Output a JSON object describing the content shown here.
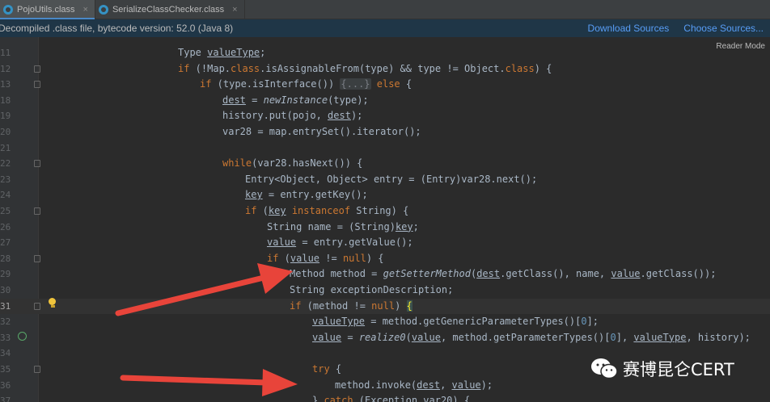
{
  "tabs": [
    {
      "label": "PojoUtils.class",
      "active": true
    },
    {
      "label": "SerializeClassChecker.class",
      "active": false
    }
  ],
  "close_glyph": "×",
  "banner": {
    "message": "Decompiled .class file, bytecode version: 52.0 (Java 8)",
    "download_sources": "Download Sources",
    "choose_sources": "Choose Sources..."
  },
  "reader_mode": "Reader Mode",
  "line_numbers": [
    "11",
    "12",
    "13",
    "18",
    "19",
    "20",
    "21",
    "22",
    "23",
    "24",
    "25",
    "26",
    "27",
    "28",
    "29",
    "30",
    "31",
    "32",
    "33",
    "34",
    "35",
    "36",
    "37"
  ],
  "code": {
    "l11": {
      "a": "Type ",
      "b": "valueType",
      "c": ";"
    },
    "l12": {
      "a": "if",
      "b": " (!Map.",
      "c": "class",
      "d": ".isAssignableFrom(type) && type != Object.",
      "e": "class",
      "f": ") {"
    },
    "l13": {
      "a": "if",
      "b": " (type.isInterface()) ",
      "c": "{...}",
      "d": " else",
      "e": " {"
    },
    "l18": {
      "a": "dest",
      "b": " = ",
      "c": "newInstance",
      "d": "(type);"
    },
    "l19": {
      "a": "history.put(pojo, ",
      "b": "dest",
      "c": ");"
    },
    "l20": {
      "a": "var28 = map.entrySet().iterator();"
    },
    "l22": {
      "a": "while",
      "b": "(var28.hasNext()) {"
    },
    "l23": {
      "a": "Entry<Object, Object> entry = (Entry)var28.next();"
    },
    "l24": {
      "a": "key",
      "b": " = entry.getKey();"
    },
    "l25": {
      "a": "if",
      "b": " (",
      "c": "key",
      "d": " instanceof",
      "e": " String) {"
    },
    "l26": {
      "a": "String name = (String)",
      "b": "key",
      "c": ";"
    },
    "l27": {
      "a": "value",
      "b": " = entry.getValue();"
    },
    "l28": {
      "a": "if",
      "b": " (",
      "c": "value",
      "d": " != ",
      "e": "null",
      "f": ") {"
    },
    "l29": {
      "a": "Method method = ",
      "b": "getSetterMethod",
      "c": "(",
      "d": "dest",
      "e": ".getClass(), name, ",
      "f": "value",
      "g": ".getClass());"
    },
    "l30": {
      "a": "String exceptionDescription;"
    },
    "l31": {
      "a": "if",
      "b": " (method != ",
      "c": "null",
      "d": ") ",
      "e": "{"
    },
    "l32": {
      "a": "valueType",
      "b": " = method.getGenericParameterTypes()[",
      "c": "0",
      "d": "];"
    },
    "l33": {
      "a": "value",
      "b": " = ",
      "c": "realize0",
      "d": "(",
      "e": "value",
      "f": ", method.getParameterTypes()[",
      "g": "0",
      "h": "], ",
      "i": "valueType",
      "j": ", history);"
    },
    "l36": {
      "a": "try",
      "b": " {"
    },
    "l37": {
      "a": "method.invoke(",
      "b": "dest",
      "c": ", ",
      "d": "value",
      "e": ");"
    },
    "l38": {
      "a": "} ",
      "b": "catch",
      "c": " (Exception var20) {"
    }
  },
  "watermark": "赛博昆仑CERT",
  "colors": {
    "arrow": "#e8443a",
    "keyword": "#cc7832",
    "method_decl": "#ffc66d",
    "link": "#589df6"
  }
}
